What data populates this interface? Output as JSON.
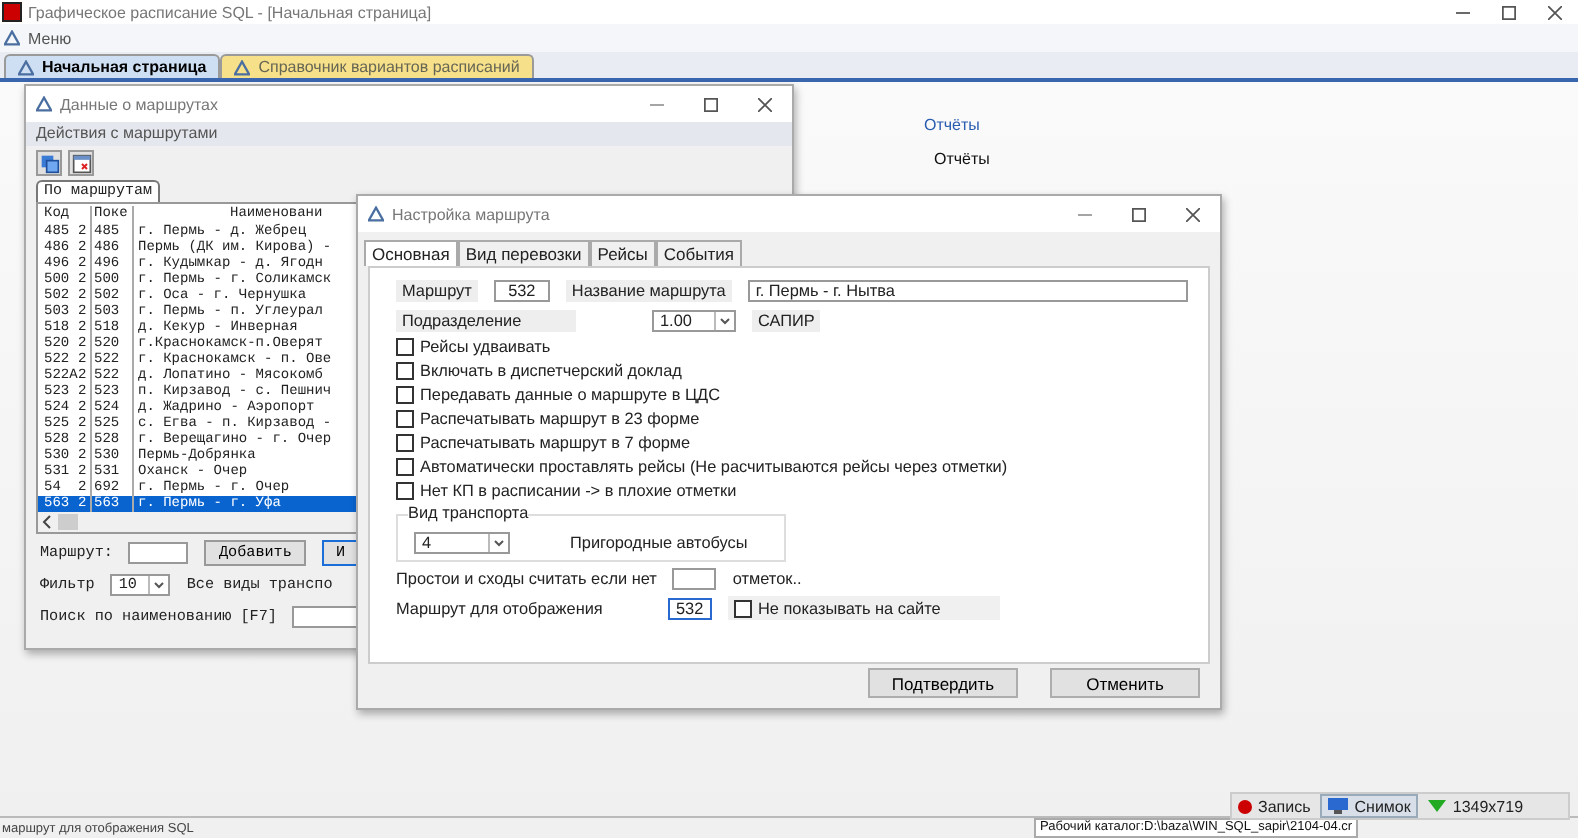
{
  "app_window": {
    "title": "Графическое расписание SQL - [Начальная страница]",
    "menu": "Меню"
  },
  "page_tabs": [
    {
      "label": "Начальная страница",
      "selected": true
    },
    {
      "label": "Справочник вариантов расписаний",
      "selected": false
    }
  ],
  "reports": {
    "link": "Отчёты",
    "heading": "Отчёты"
  },
  "routes_window": {
    "title": "Данные о маршрутах",
    "menu": "Действия с маршрутами",
    "tabs": [
      {
        "label": "По маршрутам",
        "selected": true
      }
    ],
    "columns": [
      "Код",
      "Поке",
      "Наименовани"
    ],
    "rows": [
      {
        "code": "485",
        "col2": "2",
        "col3": "485",
        "name": "г. Пермь - д. Жебрец",
        "selected": false
      },
      {
        "code": "486",
        "col2": "2",
        "col3": "486",
        "name": "Пермь (ДК им. Кирова) -",
        "selected": false
      },
      {
        "code": "496",
        "col2": "2",
        "col3": "496",
        "name": "г. Кудымкар - д. Ягодн",
        "selected": false
      },
      {
        "code": "500",
        "col2": "2",
        "col3": "500",
        "name": "г. Пермь - г. Соликамск",
        "selected": false
      },
      {
        "code": "502",
        "col2": "2",
        "col3": "502",
        "name": "г. Оса - г. Чернушка",
        "selected": false
      },
      {
        "code": "503",
        "col2": "2",
        "col3": "503",
        "name": "г. Пермь - п. Углеурал",
        "selected": false
      },
      {
        "code": "518",
        "col2": "2",
        "col3": "518",
        "name": "д. Кекур - Инверная",
        "selected": false
      },
      {
        "code": "520",
        "col2": "2",
        "col3": "520",
        "name": "г.Краснокамск-п.Оверят",
        "selected": false
      },
      {
        "code": "522",
        "col2": "2",
        "col3": "522",
        "name": "г. Краснокамск - п. Ове",
        "selected": false
      },
      {
        "code": "522А",
        "col2": "2",
        "col3": "522",
        "name": "д. Лопатино - Мясокомб",
        "selected": false
      },
      {
        "code": "523",
        "col2": "2",
        "col3": "523",
        "name": "п. Кирзавод - с. Пешнич",
        "selected": false
      },
      {
        "code": "524",
        "col2": "2",
        "col3": "524",
        "name": "д. Жадрино - Аэропорт",
        "selected": false
      },
      {
        "code": "525",
        "col2": "2",
        "col3": "525",
        "name": "с. Егва - п. Кирзавод -",
        "selected": false
      },
      {
        "code": "528",
        "col2": "2",
        "col3": "528",
        "name": "г. Верещагино - г. Очер",
        "selected": false
      },
      {
        "code": "530",
        "col2": "2",
        "col3": "530",
        "name": "Пермь-Добрянка",
        "selected": false
      },
      {
        "code": "531",
        "col2": "2",
        "col3": "531",
        "name": "Оханск - Очер",
        "selected": false
      },
      {
        "code": "54",
        "col2": "2",
        "col3": "692",
        "name": "г. Пермь - г. Очер",
        "selected": false
      },
      {
        "code": "563",
        "col2": "2",
        "col3": "563",
        "name": "г. Пермь - г. Уфа",
        "selected": true
      }
    ],
    "route_label": "Маршрут:",
    "add_button": "Добавить",
    "cut_button": "И",
    "filter_label": "Фильтр",
    "filter_value": "10",
    "filter_text": "Все виды транспо",
    "search_label": "Поиск по наименованию [F7]"
  },
  "dialog": {
    "title": "Настройка маршрута",
    "tabs": [
      {
        "label": "Основная",
        "selected": true
      },
      {
        "label": "Вид перевозки",
        "selected": false
      },
      {
        "label": "Рейсы",
        "selected": false
      },
      {
        "label": "События",
        "selected": false
      }
    ],
    "route_label": "Маршрут",
    "route_value": "532",
    "name_label": "Название маршрута",
    "name_value": "г. Пермь - г. Нытва",
    "division_label": "Подразделение",
    "division_value": "1.00",
    "division_name": "САПИР",
    "checkboxes": [
      {
        "label": "Рейсы удваивать",
        "checked": false
      },
      {
        "label": "Включать в диспетчерский доклад",
        "checked": false
      },
      {
        "label": "Передавать данные о маршруте в ЦДС",
        "checked": false
      },
      {
        "label": "Распечатывать маршрут в 23 форме",
        "checked": false
      },
      {
        "label": "Распечатывать маршрут в 7  форме",
        "checked": false
      },
      {
        "label": "Автоматически проставлять рейсы  (Не расчитываются рейсы через отметки)",
        "checked": false
      },
      {
        "label": "Нет КП в расписании -> в плохие отметки",
        "checked": false
      }
    ],
    "transport": {
      "legend": "Вид транспорта",
      "value": "4",
      "name": "Пригородные автобусы"
    },
    "idle_label": "Простои и сходы считать если нет",
    "idle_suffix": "отметок..",
    "display_label": "Маршрут для отображения",
    "display_value": "532",
    "hide_on_site": {
      "label": "Не показывать на сайте",
      "checked": false
    },
    "buttons": [
      "Подтвердить",
      "Отменить"
    ]
  },
  "recorder": {
    "record": "Запись",
    "snapshot": "Снимок",
    "size": "1349x719"
  },
  "status_bar": [
    "маршрут для отображения SQL",
    "Рабочий каталог:D:\\baza\\WIN_SQL_sapir\\2104-04.cr"
  ]
}
